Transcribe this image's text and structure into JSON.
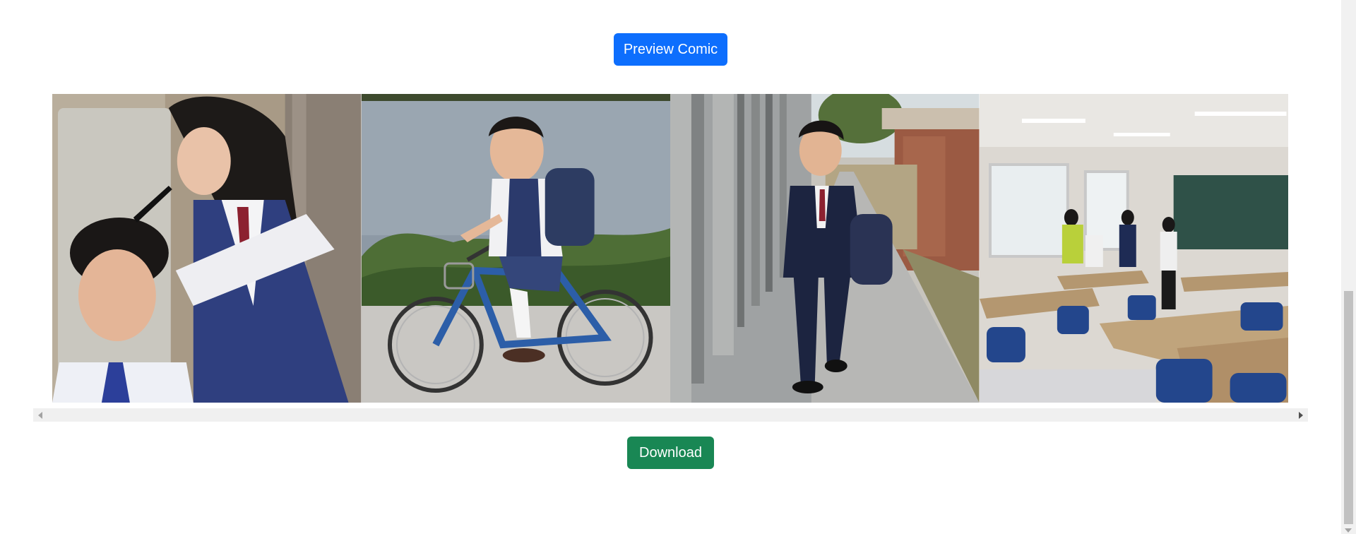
{
  "buttons": {
    "preview_label": "Preview Comic",
    "download_label": "Download"
  },
  "comic": {
    "panels": [
      {
        "subject": "girl-combing-boy-hair"
      },
      {
        "subject": "boy-riding-bicycle"
      },
      {
        "subject": "boy-walking-to-school"
      },
      {
        "subject": "classroom"
      }
    ]
  },
  "colors": {
    "primary": "#0d6efd",
    "success": "#198754"
  }
}
